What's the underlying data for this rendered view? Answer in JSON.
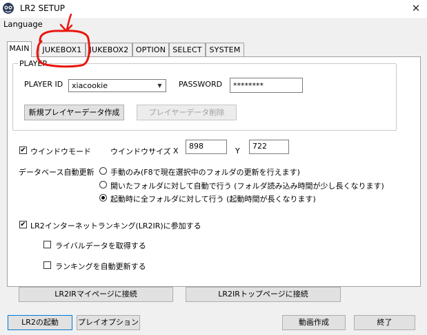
{
  "window": {
    "title": "LR2 SETUP",
    "menu": {
      "language": "Language"
    },
    "close_glyph": "✕"
  },
  "tabs": [
    {
      "label": "MAIN",
      "active": true
    },
    {
      "label": "JUKEBOX1",
      "active": false
    },
    {
      "label": "JUKEBOX2",
      "active": false
    },
    {
      "label": "OPTION",
      "active": false
    },
    {
      "label": "SELECT",
      "active": false
    },
    {
      "label": "SYSTEM",
      "active": false
    }
  ],
  "player": {
    "group_label": "PLAYER",
    "id_label": "PLAYER ID",
    "id_value": "xiacookie",
    "password_label": "PASSWORD",
    "password_value": "********",
    "create_button": "新規プレイヤーデータ作成",
    "delete_button": "プレイヤーデータ削除"
  },
  "window_mode": {
    "checkbox_label": "ウインドウモード",
    "checked": true,
    "size_label": "ウインドウサイズ",
    "x_label": "X",
    "x_value": "898",
    "y_label": "Y",
    "y_value": "722"
  },
  "database": {
    "label": "データベース自動更新",
    "options": [
      {
        "label": "手動のみ(F8で現在選択中のフォルダの更新を行えます)",
        "selected": false
      },
      {
        "label": "開いたフォルダに対して自動で行う (フォルダ読み込み時間が少し長くなります)",
        "selected": false
      },
      {
        "label": "起動時に全フォルダに対して行う (起動時間が長くなります)",
        "selected": true
      }
    ]
  },
  "internet": {
    "join_label": "LR2インターネットランキング(LR2IR)に参加する",
    "join_checked": true,
    "rival_label": "ライバルデータを取得する",
    "rival_checked": false,
    "auto_update_label": "ランキングを自動更新する",
    "auto_update_checked": false,
    "mypage_button": "LR2IRマイページに接続",
    "toppage_button": "LR2IRトップページに接続"
  },
  "footer": {
    "launch_button": "LR2の起動",
    "play_option_button": "プレイオプション",
    "movie_button": "動画作成",
    "exit_button": "終了"
  },
  "colors": {
    "annotation": "#e8160c",
    "focus_border": "#0078d7"
  },
  "icons": {
    "app": "app-icon",
    "check": "✔",
    "dropdown": "▼"
  }
}
